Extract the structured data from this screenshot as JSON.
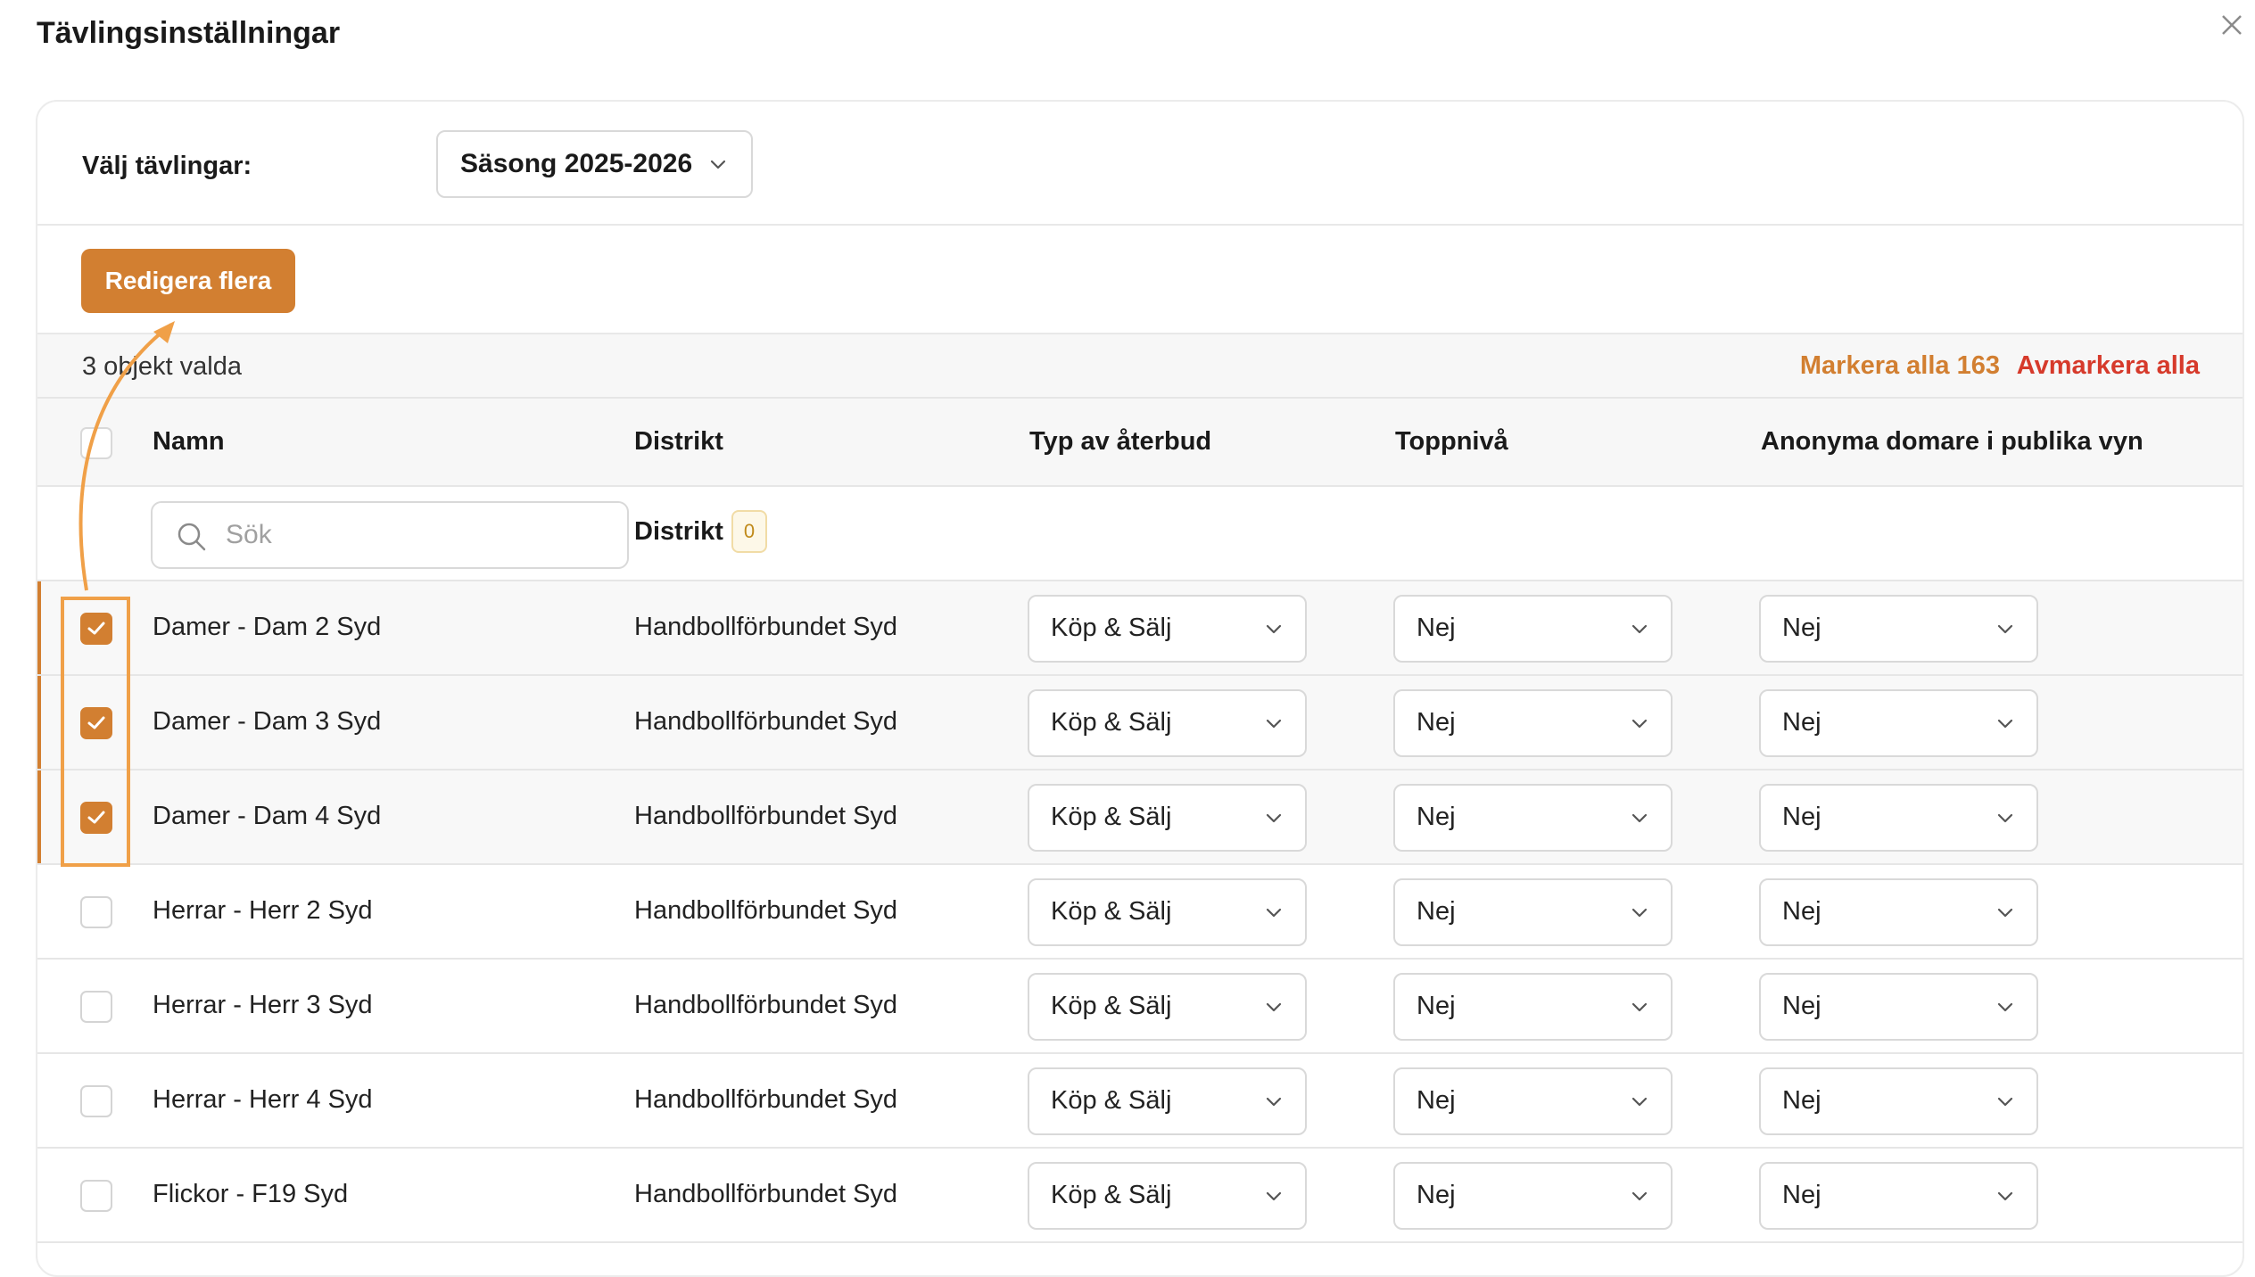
{
  "dialog": {
    "title": "Tävlingsinställningar"
  },
  "filter": {
    "label": "Välj tävlingar:",
    "season_value": "Säsong 2025-2026"
  },
  "actions": {
    "edit_many_label": "Redigera flera"
  },
  "selection": {
    "count_text": "3 objekt valda",
    "select_all_label": "Markera alla 163",
    "deselect_all_label": "Avmarkera alla"
  },
  "table": {
    "columns": {
      "name": "Namn",
      "district": "Distrikt",
      "type": "Typ av återbud",
      "top_level": "Toppnivå",
      "anon": "Anonyma domare i publika vyn"
    },
    "search_placeholder": "Sök",
    "district_filter_label": "Distrikt",
    "district_filter_count": "0",
    "rows": [
      {
        "name": "Damer - Dam 2 Syd",
        "district": "Handbollförbundet Syd",
        "type": "Köp & Sälj",
        "top_level": "Nej",
        "anon": "Nej",
        "checked": true
      },
      {
        "name": "Damer - Dam 3 Syd",
        "district": "Handbollförbundet Syd",
        "type": "Köp & Sälj",
        "top_level": "Nej",
        "anon": "Nej",
        "checked": true
      },
      {
        "name": "Damer - Dam 4 Syd",
        "district": "Handbollförbundet Syd",
        "type": "Köp & Sälj",
        "top_level": "Nej",
        "anon": "Nej",
        "checked": true
      },
      {
        "name": "Herrar - Herr 2 Syd",
        "district": "Handbollförbundet Syd",
        "type": "Köp & Sälj",
        "top_level": "Nej",
        "anon": "Nej",
        "checked": false
      },
      {
        "name": "Herrar - Herr 3 Syd",
        "district": "Handbollförbundet Syd",
        "type": "Köp & Sälj",
        "top_level": "Nej",
        "anon": "Nej",
        "checked": false
      },
      {
        "name": "Herrar - Herr 4 Syd",
        "district": "Handbollförbundet Syd",
        "type": "Köp & Sälj",
        "top_level": "Nej",
        "anon": "Nej",
        "checked": false
      },
      {
        "name": "Flickor - F19 Syd",
        "district": "Handbollförbundet Syd",
        "type": "Köp & Sälj",
        "top_level": "Nej",
        "anon": "Nej",
        "checked": false
      }
    ]
  },
  "colors": {
    "accent": "#d27f31",
    "danger": "#d63a2b",
    "annotation": "#f0a048"
  },
  "icons": {
    "close": "close-icon",
    "chevron": "chevron-down-icon",
    "search": "search-icon",
    "check": "check-icon"
  }
}
